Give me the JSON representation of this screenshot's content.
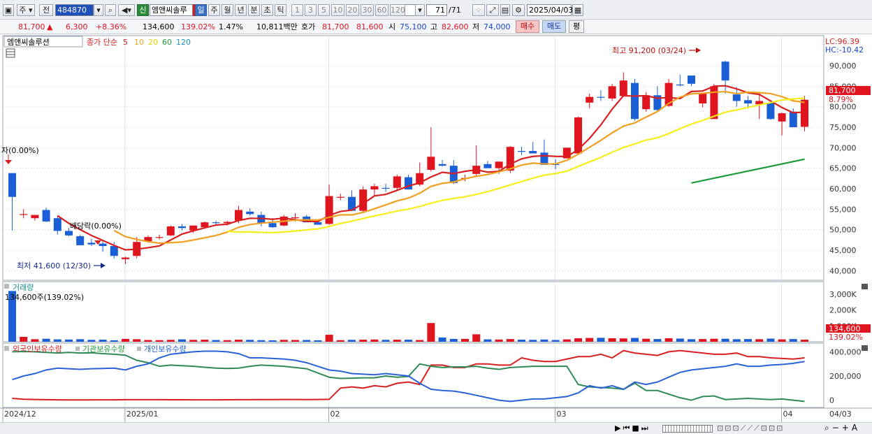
{
  "toolbar": {
    "chart_type": "주",
    "prev_label": "전",
    "code": "484870",
    "stock_name": "엠앤씨솔루",
    "shin_label": "신",
    "periods": [
      "일",
      "주",
      "월",
      "년",
      "분",
      "초",
      "틱"
    ],
    "intervals": [
      "1",
      "3",
      "5",
      "10",
      "20",
      "30",
      "60",
      "120"
    ],
    "count": "71",
    "count_total": "/71",
    "date": "2025/04/03"
  },
  "quote": {
    "price": "81,700",
    "change": "6,300",
    "change_pct": "+8.36%",
    "volume": "134,600",
    "volume_ratio": "139.02%",
    "turnover": "1.47%",
    "amount": "10,811백만",
    "hoga_label": "호가",
    "ask": "81,700",
    "bid": "81,600",
    "open_label": "시",
    "open": "75,100",
    "high_label": "고",
    "high": "82,600",
    "low_label": "저",
    "low": "74,000",
    "buy_label": "매수",
    "sell_label": "매도",
    "eval_label": "평"
  },
  "price_panel": {
    "name": "엠앤씨솔루션",
    "ma_label": "종가 단순",
    "ma_periods": [
      "5",
      "10",
      "20",
      "60",
      "120"
    ],
    "lc": "LC:96.39",
    "hc": "HC:-10.42",
    "last_price": "81,700",
    "last_pct": "8.79%",
    "y_ticks": [
      "90,000",
      "85,000",
      "80,000",
      "75,000",
      "70,000",
      "65,000",
      "60,000",
      "55,000",
      "50,000",
      "45,000",
      "40,000"
    ],
    "high_note": "최고 91,200 (03/24)",
    "low_note": "최저 41,600 (12/30)",
    "note1": "자(0.00%)",
    "note2": "배당락(0.00%)"
  },
  "volume_panel": {
    "title": "거래량",
    "value_note": "134,600주(139.02%)",
    "y_ticks": [
      "3,000K",
      "2,000K",
      "1,000K"
    ],
    "last": "134,600",
    "last_pct": "139.02%"
  },
  "holding_panel": {
    "series_names": [
      "외국인보유수량",
      "기관보유수량",
      "개인보유수량"
    ],
    "y_ticks": [
      "400,000",
      "200,000",
      "0"
    ]
  },
  "x_labels": [
    "2024/12",
    "2025/01",
    "02",
    "03",
    "04",
    "04/03"
  ],
  "colors": {
    "up": "#e0141e",
    "down": "#1a5fd6",
    "ma5": "#d81f1f",
    "ma10": "#f0a020",
    "ma20": "#f5ee1a",
    "ma60": "#1f9a3a",
    "ma120": "#1a8fc8"
  },
  "chart_data": {
    "type": "candlestick",
    "n": 71,
    "ohlc": [
      [
        63800,
        63800,
        49800,
        58000
      ],
      [
        53800,
        55000,
        52800,
        53800
      ],
      [
        52800,
        53600,
        52200,
        53600
      ],
      [
        54800,
        55400,
        51800,
        52000
      ],
      [
        52800,
        53400,
        48800,
        49700
      ],
      [
        49700,
        50400,
        48400,
        48600
      ],
      [
        48400,
        48800,
        46200,
        46200
      ],
      [
        46800,
        47800,
        46000,
        46400
      ],
      [
        46600,
        47400,
        44600,
        46000
      ],
      [
        46000,
        47000,
        43000,
        43600
      ],
      [
        42800,
        43400,
        41600,
        43200
      ],
      [
        43600,
        48200,
        43000,
        47000
      ],
      [
        47200,
        48600,
        46800,
        48200
      ],
      [
        48000,
        48800,
        47600,
        48200
      ],
      [
        48600,
        51000,
        48400,
        50800
      ],
      [
        50800,
        51400,
        49800,
        50400
      ],
      [
        49800,
        51000,
        49200,
        51000
      ],
      [
        50600,
        52000,
        50400,
        51800
      ],
      [
        51800,
        52200,
        50900,
        51600
      ],
      [
        51600,
        52200,
        51000,
        51900
      ],
      [
        52200,
        55800,
        51600,
        54800
      ],
      [
        54400,
        55200,
        53400,
        53800
      ],
      [
        53600,
        54400,
        50800,
        51600
      ],
      [
        51600,
        52800,
        50400,
        50600
      ],
      [
        51000,
        53600,
        50800,
        53200
      ],
      [
        53000,
        54000,
        52000,
        53000
      ],
      [
        53200,
        53600,
        51800,
        51800
      ],
      [
        51800,
        52400,
        51400,
        51200
      ],
      [
        51400,
        61000,
        51200,
        58200
      ],
      [
        57800,
        58800,
        57200,
        58000
      ],
      [
        58000,
        59600,
        54600,
        54600
      ],
      [
        54600,
        60600,
        54400,
        59800
      ],
      [
        59800,
        61200,
        58200,
        60600
      ],
      [
        60200,
        61200,
        59200,
        60000
      ],
      [
        60200,
        63400,
        59600,
        63000
      ],
      [
        62800,
        63400,
        59800,
        59800
      ],
      [
        61000,
        66400,
        60600,
        63800
      ],
      [
        64600,
        75000,
        64200,
        67800
      ],
      [
        66000,
        67000,
        65400,
        65600
      ],
      [
        65600,
        67000,
        61200,
        61400
      ],
      [
        62600,
        63400,
        61800,
        62600
      ],
      [
        63600,
        70600,
        63000,
        65600
      ],
      [
        66000,
        66800,
        65400,
        65000
      ],
      [
        65000,
        66600,
        63600,
        66600
      ],
      [
        64400,
        70400,
        63800,
        70200
      ],
      [
        69200,
        70200,
        68200,
        69000
      ],
      [
        69200,
        71400,
        68600,
        68600
      ],
      [
        68800,
        72000,
        66000,
        65800
      ],
      [
        66000,
        67200,
        64800,
        65800
      ],
      [
        67400,
        70000,
        67400,
        70000
      ],
      [
        68600,
        77600,
        68400,
        77400
      ],
      [
        81000,
        83200,
        79600,
        82400
      ],
      [
        82400,
        84000,
        81400,
        82200
      ],
      [
        82000,
        85600,
        81400,
        85000
      ],
      [
        82600,
        88400,
        82600,
        86400
      ],
      [
        85800,
        86800,
        76600,
        77000
      ],
      [
        79400,
        83600,
        78800,
        82800
      ],
      [
        82800,
        85000,
        79000,
        79200
      ],
      [
        80200,
        86800,
        80000,
        85800
      ],
      [
        85400,
        87800,
        85000,
        85200
      ],
      [
        87600,
        87600,
        85000,
        85600
      ],
      [
        80800,
        83200,
        79800,
        83400
      ],
      [
        77000,
        85600,
        77000,
        85000
      ],
      [
        91000,
        91200,
        83200,
        86400
      ],
      [
        83000,
        84800,
        80000,
        81400
      ],
      [
        81600,
        82600,
        79800,
        80800
      ],
      [
        80600,
        83400,
        77000,
        81400
      ],
      [
        81000,
        81600,
        76800,
        77000
      ],
      [
        76400,
        78600,
        73000,
        78400
      ],
      [
        78800,
        79600,
        75000,
        75000
      ],
      [
        75100,
        82600,
        74000,
        81700
      ]
    ],
    "ma60_line": [
      [
        60,
        61400
      ],
      [
        70,
        67200
      ]
    ],
    "volume": [
      3200,
      310,
      160,
      190,
      150,
      140,
      160,
      120,
      130,
      90,
      180,
      160,
      110,
      100,
      120,
      150,
      120,
      130,
      110,
      100,
      130,
      120,
      100,
      90,
      120,
      110,
      110,
      90,
      440,
      100,
      120,
      130,
      140,
      120,
      130,
      130,
      110,
      1180,
      270,
      180,
      180,
      470,
      150,
      140,
      170,
      130,
      120,
      140,
      110,
      150,
      220,
      240,
      250,
      220,
      210,
      240,
      190,
      170,
      220,
      200,
      160,
      170,
      190,
      190,
      160,
      170,
      160,
      200,
      150,
      170,
      130
    ],
    "foreign_hold": [
      15000,
      8000,
      6000,
      4000,
      3000,
      2000,
      2000,
      2500,
      2500,
      3000,
      4000,
      4500,
      4000,
      4000,
      3500,
      3500,
      3000,
      3000,
      3000,
      3500,
      4000,
      4000,
      5000,
      5000,
      6000,
      6000,
      5000,
      6000,
      7000,
      100000,
      110000,
      100000,
      120000,
      110000,
      140000,
      150000,
      130000,
      290000,
      290000,
      270000,
      270000,
      300000,
      300000,
      290000,
      290000,
      350000,
      330000,
      320000,
      320000,
      340000,
      360000,
      360000,
      380000,
      350000,
      410000,
      390000,
      380000,
      370000,
      400000,
      410000,
      400000,
      390000,
      380000,
      380000,
      390000,
      360000,
      360000,
      350000,
      345000,
      340000,
      350000
    ],
    "inst_hold": [
      400000,
      402000,
      400000,
      395000,
      390000,
      395000,
      390000,
      392000,
      385000,
      380000,
      372000,
      330000,
      310000,
      280000,
      290000,
      285000,
      280000,
      272000,
      265000,
      262000,
      265000,
      280000,
      290000,
      285000,
      280000,
      270000,
      260000,
      225000,
      190000,
      180000,
      182000,
      185000,
      185000,
      200000,
      190000,
      196000,
      300000,
      280000,
      270000,
      275000,
      275000,
      280000,
      265000,
      255000,
      270000,
      275000,
      280000,
      280000,
      280000,
      280000,
      130000,
      110000,
      105000,
      100000,
      90000,
      140000,
      80000,
      80000,
      50000,
      20000,
      0,
      30000,
      35000,
      5000,
      10000,
      15000,
      10000,
      5000,
      10000,
      0,
      -10000
    ],
    "indiv_hold": [
      170000,
      200000,
      220000,
      250000,
      265000,
      260000,
      255000,
      260000,
      262000,
      265000,
      250000,
      280000,
      300000,
      350000,
      380000,
      390000,
      400000,
      405000,
      405000,
      400000,
      385000,
      350000,
      350000,
      345000,
      340000,
      330000,
      310000,
      280000,
      250000,
      240000,
      220000,
      215000,
      210000,
      220000,
      210000,
      200000,
      140000,
      90000,
      80000,
      75000,
      60000,
      40000,
      20000,
      0,
      -10000,
      0,
      10000,
      10000,
      20000,
      30000,
      60000,
      120000,
      100000,
      120000,
      90000,
      150000,
      130000,
      150000,
      190000,
      230000,
      250000,
      260000,
      270000,
      280000,
      300000,
      280000,
      280000,
      290000,
      295000,
      305000,
      320000
    ],
    "price_ylim": [
      38000,
      97000
    ],
    "volume_ylim": [
      0,
      3700
    ],
    "hold_ylim": [
      -60000,
      460000
    ]
  }
}
